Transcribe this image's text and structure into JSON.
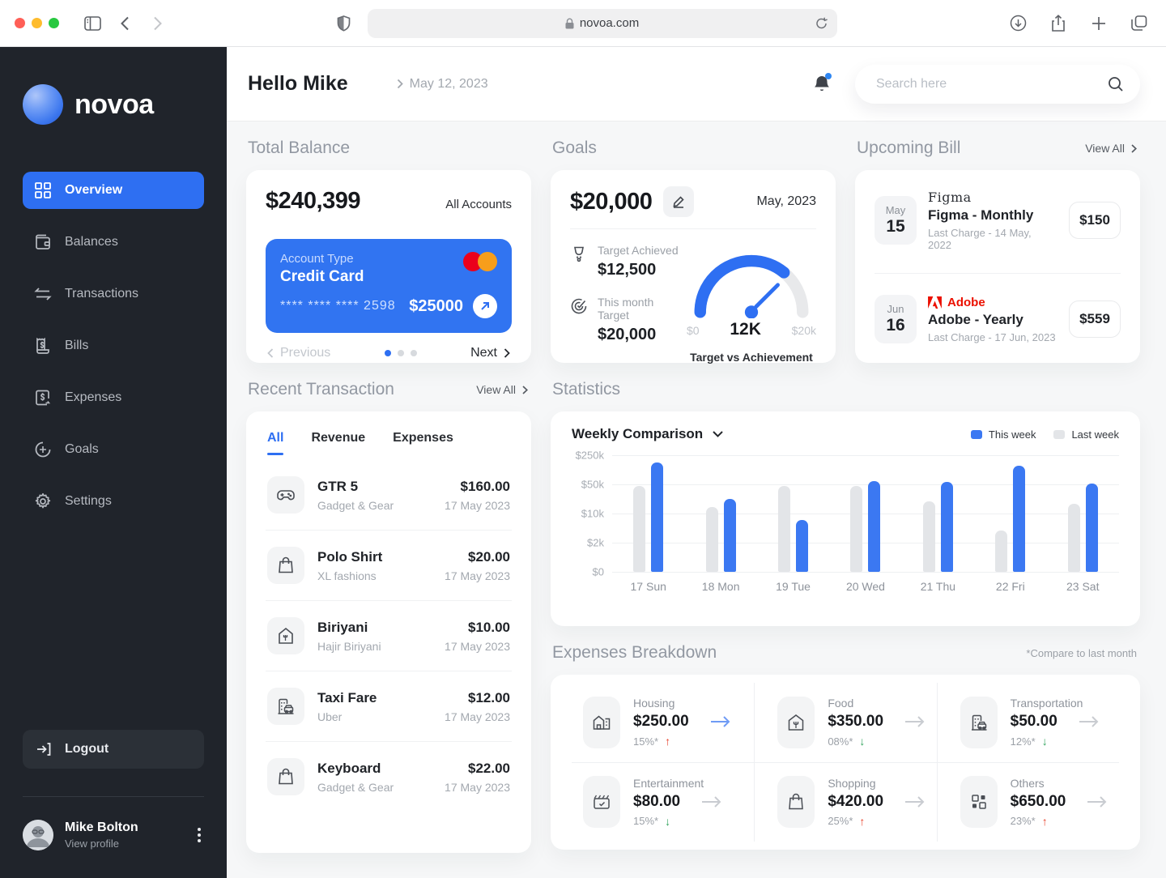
{
  "browser": {
    "url": "novoa.com",
    "icons": [
      "sidebar-toggle-icon",
      "back-icon",
      "forward-icon",
      "shield-icon",
      "lock-icon",
      "reload-icon",
      "downloads-icon",
      "share-icon",
      "new-tab-icon",
      "tabs-icon"
    ]
  },
  "brand": {
    "name": "novoa"
  },
  "sidebar": {
    "items": [
      {
        "label": "Overview",
        "icon": "grid-icon",
        "active": true
      },
      {
        "label": "Balances",
        "icon": "wallet-icon",
        "active": false
      },
      {
        "label": "Transactions",
        "icon": "transfer-icon",
        "active": false
      },
      {
        "label": "Bills",
        "icon": "receipt-icon",
        "active": false
      },
      {
        "label": "Expenses",
        "icon": "expense-icon",
        "active": false
      },
      {
        "label": "Goals",
        "icon": "target-icon",
        "active": false
      },
      {
        "label": "Settings",
        "icon": "gear-icon",
        "active": false
      }
    ],
    "logout_label": "Logout",
    "profile": {
      "name": "Mike Bolton",
      "sub": "View profile"
    }
  },
  "header": {
    "greeting": "Hello Mike",
    "date": "May 12, 2023",
    "search_placeholder": "Search here"
  },
  "total_balance": {
    "title": "Total Balance",
    "amount": "$240,399",
    "accounts_label": "All Accounts",
    "card": {
      "type_label": "Account Type",
      "type_value": "Credit Card",
      "masked_number": "**** **** **** 2598",
      "amount": "$25000",
      "network": "mastercard"
    },
    "pager": {
      "prev": "Previous",
      "next": "Next",
      "dots": [
        "active",
        "",
        ""
      ]
    }
  },
  "goals": {
    "title": "Goals",
    "amount": "$20,000",
    "month": "May, 2023",
    "target_achieved_label": "Target Achieved",
    "target_achieved_value": "$12,500",
    "month_target_label": "This month Target",
    "month_target_value": "$20,000",
    "gauge": {
      "min": "$0",
      "value": "12K",
      "max": "$20k",
      "caption": "Target vs Achievement",
      "fill_pct": 72
    }
  },
  "upcoming_bill": {
    "title": "Upcoming Bill",
    "view_all": "View All",
    "items": [
      {
        "month": "May",
        "day": "15",
        "brand": "Figma",
        "title": "Figma - Monthly",
        "last_charge": "Last Charge - 14 May, 2022",
        "amount": "$150"
      },
      {
        "month": "Jun",
        "day": "16",
        "brand": "Adobe",
        "title": "Adobe - Yearly",
        "last_charge": "Last Charge - 17 Jun, 2023",
        "amount": "$559"
      }
    ]
  },
  "recent_transactions": {
    "title": "Recent Transaction",
    "view_all": "View All",
    "tabs": [
      {
        "label": "All",
        "state": "active"
      },
      {
        "label": "Revenue",
        "state": ""
      },
      {
        "label": "Expenses",
        "state": ""
      }
    ],
    "items": [
      {
        "name": "GTR 5",
        "category": "Gadget & Gear",
        "amount": "$160.00",
        "date": "17 May 2023",
        "icon": "gamepad-icon"
      },
      {
        "name": "Polo Shirt",
        "category": "XL fashions",
        "amount": "$20.00",
        "date": "17 May 2023",
        "icon": "shopping-bag-icon"
      },
      {
        "name": "Biriyani",
        "category": "Hajir Biriyani",
        "amount": "$10.00",
        "date": "17 May 2023",
        "icon": "restaurant-icon"
      },
      {
        "name": "Taxi Fare",
        "category": "Uber",
        "amount": "$12.00",
        "date": "17 May 2023",
        "icon": "taxi-building-icon"
      },
      {
        "name": "Keyboard",
        "category": "Gadget & Gear",
        "amount": "$22.00",
        "date": "17 May 2023",
        "icon": "shopping-bag-icon"
      }
    ]
  },
  "statistics": {
    "title": "Statistics",
    "dropdown_label": "Weekly Comparison",
    "chart_data": {
      "type": "bar",
      "categories": [
        "17 Sun",
        "18 Mon",
        "19 Tue",
        "20 Wed",
        "21 Thu",
        "22 Fri",
        "23 Sat"
      ],
      "series": [
        {
          "name": "This week",
          "color": "#3b78f2",
          "values": [
            170000,
            22000,
            7000,
            60000,
            58000,
            140000,
            52000
          ]
        },
        {
          "name": "Last week",
          "color": "#e3e5e8",
          "values": [
            45000,
            14000,
            45000,
            45000,
            20000,
            4000,
            17000
          ]
        }
      ],
      "y_ticks": [
        "$250k",
        "$50k",
        "$10k",
        "$2k",
        "$0"
      ],
      "scale_stops_usd": [
        0,
        2000,
        10000,
        50000,
        250000
      ],
      "scale": "piecewise-log (each gridline step = 5x)",
      "grid": true,
      "legend_position": "top-right"
    }
  },
  "expenses_breakdown": {
    "title": "Expenses Breakdown",
    "note": "*Compare to last month",
    "cells": [
      {
        "label": "Housing",
        "amount": "$250.00",
        "pct": "15%*",
        "trend": "up",
        "trend_icon": "↑",
        "icon": "home-icon",
        "arrow_accent": "blue"
      },
      {
        "label": "Food",
        "amount": "$350.00",
        "pct": "08%*",
        "trend": "down",
        "trend_icon": "↓",
        "icon": "food-store-icon",
        "arrow_accent": "gray"
      },
      {
        "label": "Transportation",
        "amount": "$50.00",
        "pct": "12%*",
        "trend": "down",
        "trend_icon": "↓",
        "icon": "transport-icon",
        "arrow_accent": "gray"
      },
      {
        "label": "Entertainment",
        "amount": "$80.00",
        "pct": "15%*",
        "trend": "down",
        "trend_icon": "↓",
        "icon": "clapperboard-icon",
        "arrow_accent": "gray"
      },
      {
        "label": "Shopping",
        "amount": "$420.00",
        "pct": "25%*",
        "trend": "up",
        "trend_icon": "↑",
        "icon": "shopping-bag-icon",
        "arrow_accent": "gray"
      },
      {
        "label": "Others",
        "amount": "$650.00",
        "pct": "23%*",
        "trend": "up",
        "trend_icon": "↑",
        "icon": "grid-mixed-icon",
        "arrow_accent": "gray"
      }
    ]
  },
  "colors": {
    "accent_blue": "#2e6ff2",
    "card_blue": "#3174f1",
    "bar_blue": "#3b78f2",
    "bar_gray": "#e3e5e8",
    "trend_red": "#e8402a",
    "trend_green": "#31a35c",
    "adobe_red": "#eb1000",
    "mastercard_red": "#eb001b",
    "mastercard_orange": "#f79e1b",
    "sidebar_bg": "#20242b"
  }
}
